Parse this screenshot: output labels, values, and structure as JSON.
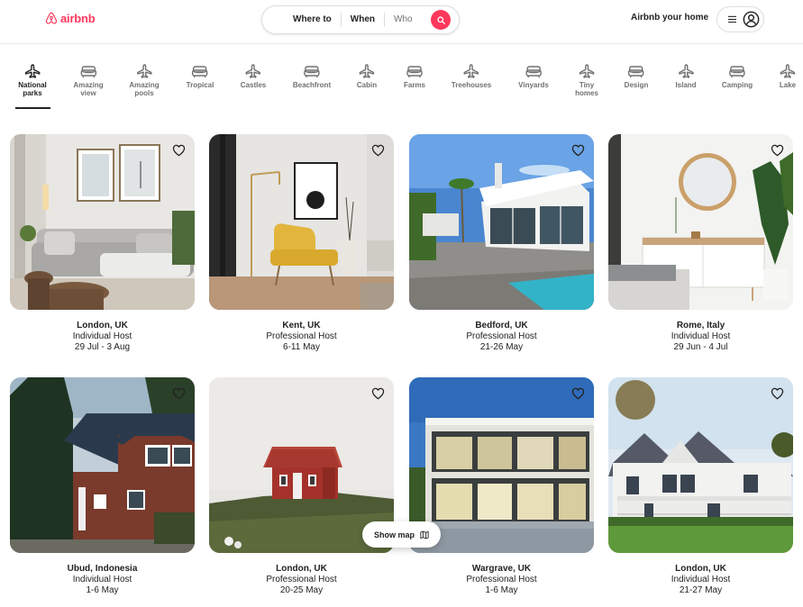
{
  "header": {
    "logo_text": "airbnb",
    "search": {
      "where": "Where to",
      "when": "When",
      "who": "Who"
    },
    "host_link": "Airbnb your home",
    "brand_color": "#ff385c"
  },
  "categories": [
    {
      "label": "National\nparks",
      "icon": "plane-icon",
      "active": true
    },
    {
      "label": "Amazing\nview",
      "icon": "sofa-icon"
    },
    {
      "label": "Amazing\npools",
      "icon": "plane-icon"
    },
    {
      "label": "Tropical",
      "icon": "sofa-icon"
    },
    {
      "label": "Castles",
      "icon": "plane-icon"
    },
    {
      "label": "Beachfront",
      "icon": "sofa-icon"
    },
    {
      "label": "Cabin",
      "icon": "plane-icon"
    },
    {
      "label": "Farms",
      "icon": "sofa-icon"
    },
    {
      "label": "Treehouses",
      "icon": "plane-icon"
    },
    {
      "label": "Vinyards",
      "icon": "sofa-icon"
    },
    {
      "label": "Tiny\nhomes",
      "icon": "plane-icon"
    },
    {
      "label": "Design",
      "icon": "sofa-icon"
    },
    {
      "label": "Island",
      "icon": "plane-icon"
    },
    {
      "label": "Camping",
      "icon": "sofa-icon"
    },
    {
      "label": "Lake",
      "icon": "plane-icon"
    }
  ],
  "listings": [
    {
      "location": "London, UK",
      "host": "Individual Host",
      "dates": "29 Jul - 3 Aug",
      "image": "living-room-grey-sofa"
    },
    {
      "location": "Kent, UK",
      "host": "Professional Host",
      "dates": "6-11 May",
      "image": "room-yellow-armchair"
    },
    {
      "location": "Bedford, UK",
      "host": "Professional Host",
      "dates": "21-26 May",
      "image": "modern-white-villa-pool"
    },
    {
      "location": "Rome, Italy",
      "host": "Individual Host",
      "dates": "29 Jun - 4 Jul",
      "image": "bedroom-round-mirror"
    },
    {
      "location": "Ubud, Indonesia",
      "host": "Individual Host",
      "dates": "1-6 May",
      "image": "brick-house-forest"
    },
    {
      "location": "London, UK",
      "host": "Professional Host",
      "dates": "20-25 May",
      "image": "small-red-cabin"
    },
    {
      "location": "Wargrave, UK",
      "host": "Professional Host",
      "dates": "1-6 May",
      "image": "glass-modern-house-night"
    },
    {
      "location": "London, UK",
      "host": "Individual Host",
      "dates": "21-27 May",
      "image": "white-victorian-house"
    }
  ],
  "show_map": {
    "label": "Show map",
    "icon": "map-icon"
  }
}
